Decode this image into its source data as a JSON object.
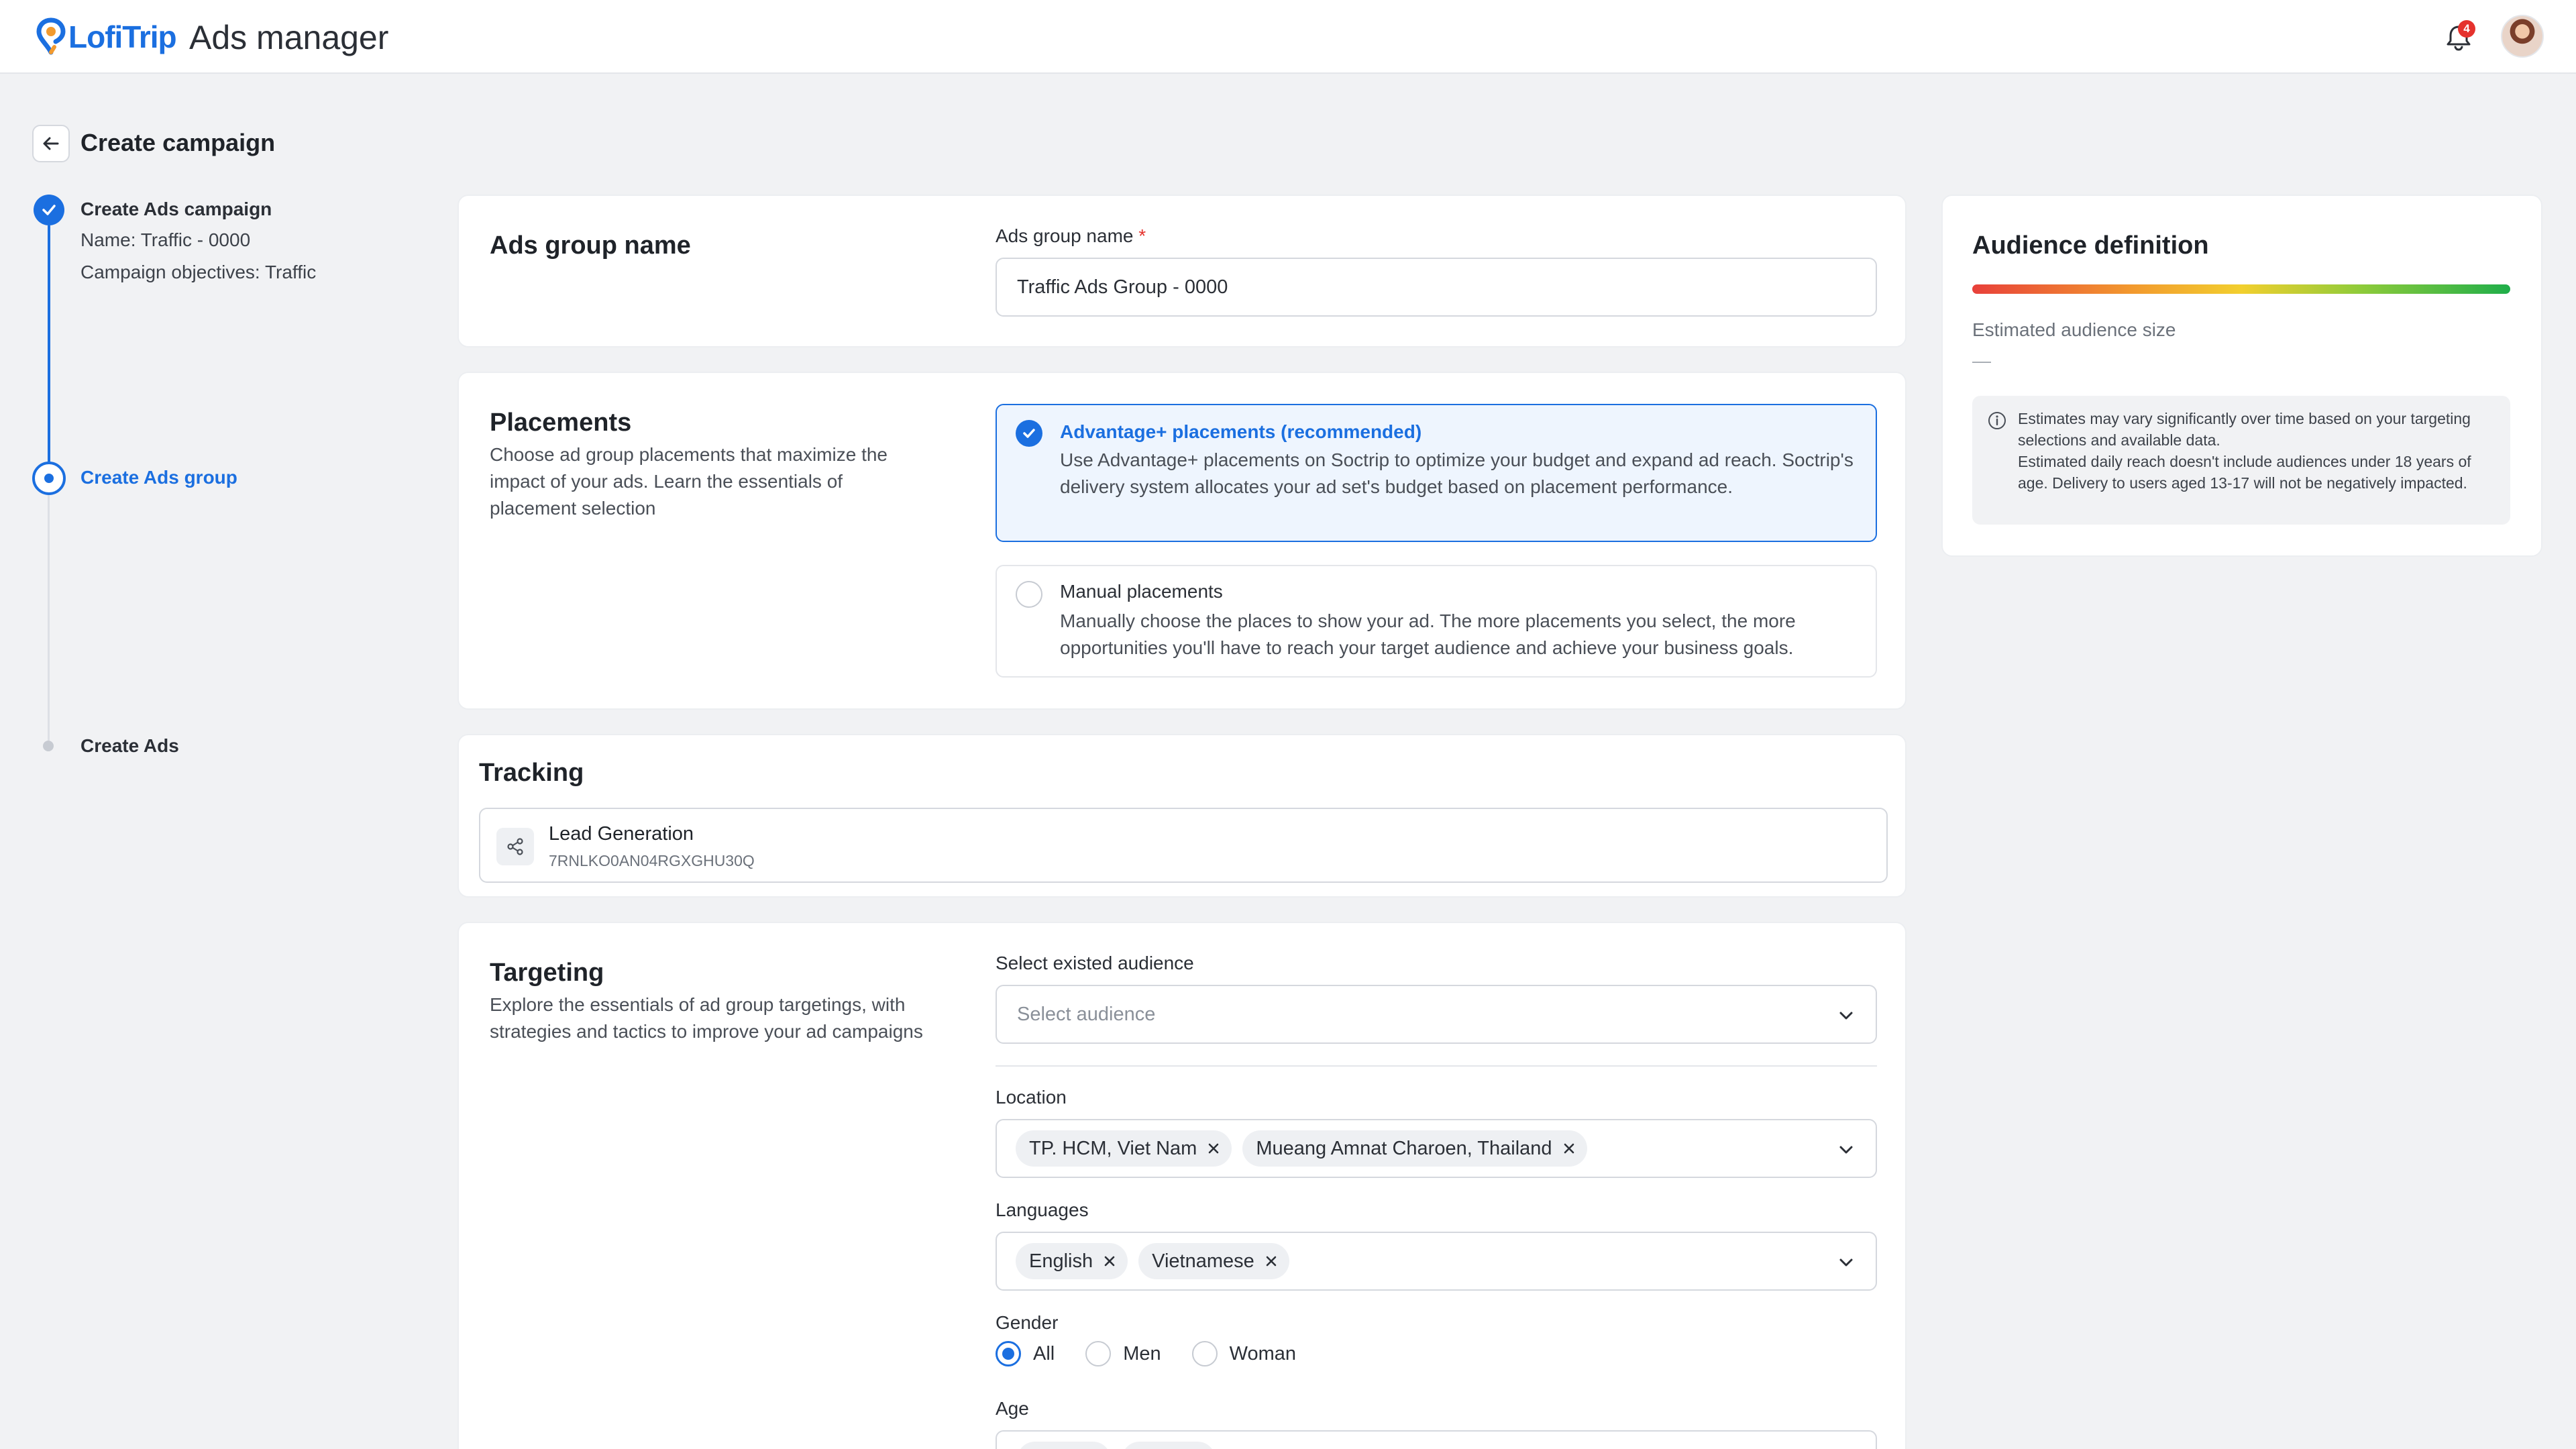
{
  "header": {
    "logo_text": "LofiTrip",
    "app_title": "Ads manager",
    "notification_count": "4"
  },
  "page": {
    "title": "Create campaign"
  },
  "stepper": {
    "steps": [
      {
        "title": "Create Ads campaign",
        "status": "done",
        "lines": [
          "Name: Traffic - 0000",
          "Campaign objectives: Traffic"
        ]
      },
      {
        "title": "Create Ads group",
        "status": "active"
      },
      {
        "title": "Create Ads",
        "status": "pending"
      }
    ]
  },
  "ads_group_name": {
    "heading": "Ads group name",
    "field_label": "Ads group name",
    "required_mark": "*",
    "value": "Traffic Ads Group - 0000"
  },
  "placements": {
    "heading": "Placements",
    "description": "Choose ad group placements that maximize the impact of your ads. Learn the essentials of placement selection",
    "options": [
      {
        "title": "Advantage+ placements (recommended)",
        "description": "Use Advantage+ placements on Soctrip to optimize your budget and expand ad reach. Soctrip's delivery system allocates your ad set's budget based on placement performance.",
        "selected": true
      },
      {
        "title": "Manual placements",
        "description": "Manually choose the places to show your ad. The more placements you select, the more opportunities you'll have to reach your target audience and achieve your business goals.",
        "selected": false
      }
    ]
  },
  "tracking": {
    "heading": "Tracking",
    "item_title": "Lead Generation",
    "item_id": "7RNLKO0AN04RGXGHU30Q"
  },
  "targeting": {
    "heading": "Targeting",
    "description": "Explore the essentials of ad group targetings, with strategies and tactics to improve your ad campaigns",
    "audience_label": "Select existed audience",
    "audience_placeholder": "Select audience",
    "location_label": "Location",
    "locations": [
      "TP. HCM, Viet Nam",
      "Mueang Amnat Charoen, Thailand"
    ],
    "languages_label": "Languages",
    "languages": [
      "English",
      "Vietnamese"
    ],
    "gender_label": "Gender",
    "gender_options": [
      "All",
      "Men",
      "Woman"
    ],
    "gender_selected": "All",
    "age_label": "Age"
  },
  "audience": {
    "heading": "Audience definition",
    "size_label": "Estimated audience size",
    "size_value": "—",
    "info_text": "Estimates may vary significantly over time based on your targeting selections and available data.\nEstimated daily reach doesn't include audiences under 18 years of age. Delivery to users aged 13-17 will not be negatively impacted."
  },
  "colors": {
    "primary": "#1b6fe0",
    "danger": "#e5322d",
    "background": "#f1f2f4"
  }
}
